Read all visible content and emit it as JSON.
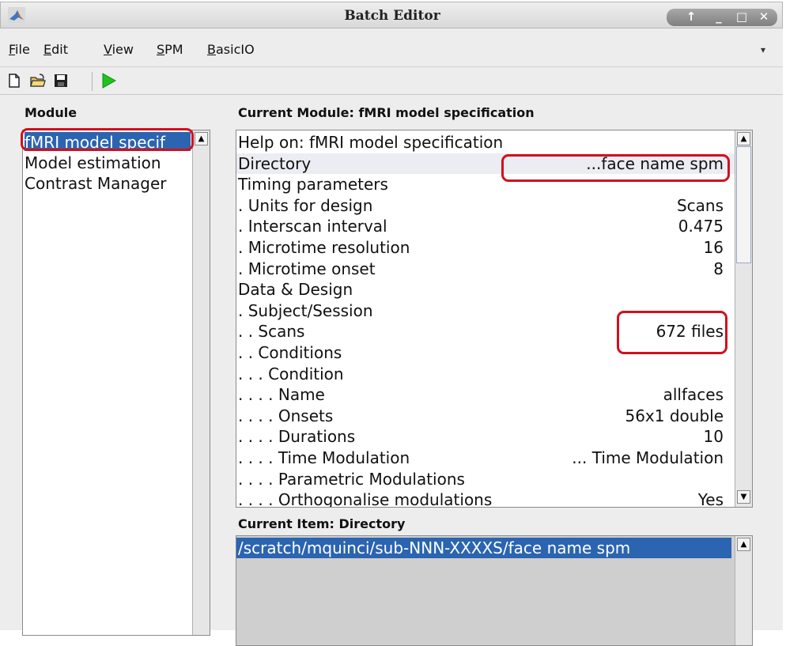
{
  "window": {
    "title": "Batch Editor"
  },
  "menu": [
    {
      "label": "File",
      "key": "file"
    },
    {
      "label": "Edit",
      "key": "edit"
    },
    {
      "label": "View",
      "key": "view"
    },
    {
      "label": "SPM",
      "key": "spm"
    },
    {
      "label": "BasicIO",
      "key": "basicio"
    }
  ],
  "toolbar": {
    "new_icon": "new-file-icon",
    "open_icon": "open-folder-icon",
    "save_icon": "floppy-disk-icon",
    "run_icon": "run-triangle-icon"
  },
  "module_panel": {
    "header": "Module",
    "items": [
      "fMRI model specif",
      "Model estimation",
      "Contrast Manager"
    ],
    "selected_index": 0
  },
  "current_module": {
    "header": "Current Module: fMRI model specification",
    "rows": [
      {
        "label": "Help on: fMRI model specification",
        "value": ""
      },
      {
        "label": "Directory",
        "value": "...face name spm"
      },
      {
        "label": "Timing parameters",
        "value": ""
      },
      {
        "label": ". Units for design",
        "value": "Scans"
      },
      {
        "label": ". Interscan interval",
        "value": "0.475"
      },
      {
        "label": ". Microtime resolution",
        "value": "16"
      },
      {
        "label": ". Microtime onset",
        "value": "8"
      },
      {
        "label": "Data & Design",
        "value": ""
      },
      {
        "label": ". Subject/Session",
        "value": ""
      },
      {
        "label": ". . Scans",
        "value": "672 files"
      },
      {
        "label": ". . Conditions",
        "value": ""
      },
      {
        "label": ". . . Condition",
        "value": ""
      },
      {
        "label": ". . . . Name",
        "value": "allfaces"
      },
      {
        "label": ". . . . Onsets",
        "value": "56x1 double"
      },
      {
        "label": ". . . . Durations",
        "value": "10"
      },
      {
        "label": ". . . . Time Modulation",
        "value": "... Time Modulation"
      },
      {
        "label": ". . . . Parametric Modulations",
        "value": ""
      },
      {
        "label": ". . . . Orthogonalise modulations",
        "value": "Yes"
      }
    ]
  },
  "current_item": {
    "header": "Current Item: Directory",
    "value": "/scratch/mquinci/sub-NNN-XXXXS/face name spm"
  },
  "colors": {
    "selection": "#2b64b0",
    "highlight_row": "#ececf3",
    "annotation": "#d1101d",
    "run_green": "#1fc21f"
  }
}
